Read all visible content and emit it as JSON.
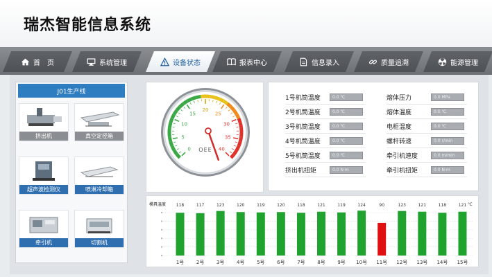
{
  "app": {
    "title": "瑞杰智能信息系统"
  },
  "tabs": [
    {
      "label": "首　页",
      "icon": "home-icon",
      "active": false
    },
    {
      "label": "系统管理",
      "icon": "monitor-icon",
      "active": false
    },
    {
      "label": "设备状态",
      "icon": "warning-icon",
      "active": true
    },
    {
      "label": "报表中心",
      "icon": "book-icon",
      "active": false
    },
    {
      "label": "信息录入",
      "icon": "document-icon",
      "active": false
    },
    {
      "label": "质量追溯",
      "icon": "link-icon",
      "active": false
    },
    {
      "label": "能源管理",
      "icon": "radiation-icon",
      "active": false
    }
  ],
  "line": {
    "title": "J01生产线"
  },
  "equipment": [
    {
      "label": "挤出机",
      "style": "gray"
    },
    {
      "label": "真空定径箱",
      "style": "gray"
    },
    {
      "label": "超声波检测仪",
      "style": "blue"
    },
    {
      "label": "喷淋冷却箱",
      "style": "blue"
    },
    {
      "label": "牵引机",
      "style": "blue"
    },
    {
      "label": "切割机",
      "style": "blue"
    }
  ],
  "gauge": {
    "label": "OEE",
    "ticks": [
      "0",
      "5",
      "10",
      "15",
      "20",
      "25",
      "30",
      "35",
      "40"
    ],
    "value": 20,
    "max": 40
  },
  "params_left": [
    {
      "label": "1号机筒温度",
      "value": "0.0 ℃"
    },
    {
      "label": "2号机筒温度",
      "value": "0.0 ℃"
    },
    {
      "label": "3号机筒温度",
      "value": "0.0 ℃"
    },
    {
      "label": "4号机筒温度",
      "value": "0.0 ℃"
    },
    {
      "label": "5号机筒温度",
      "value": "0.0 ℃"
    },
    {
      "label": "挤出机扭矩",
      "value": "0.0 N·m"
    }
  ],
  "params_right": [
    {
      "label": "熔体压力",
      "value": "0.0 MPa"
    },
    {
      "label": "熔体温度",
      "value": "0.0 ℃"
    },
    {
      "label": "电柜温度",
      "value": "0.0 ℃"
    },
    {
      "label": "螺杆转速",
      "value": "0.0 r/min"
    },
    {
      "label": "牵引机速度",
      "value": "0.0 m/min"
    },
    {
      "label": "牵引机扭矩",
      "value": "0.0 N·m"
    }
  ],
  "chart_data": {
    "type": "bar",
    "ylabel": "模具温度",
    "unit": "℃",
    "categories": [
      "1号",
      "2号",
      "3号",
      "4号",
      "5号",
      "6号",
      "7号",
      "8号",
      "9号",
      "10号",
      "11号",
      "12号",
      "13号",
      "14号",
      "15号"
    ],
    "values": [
      118,
      117,
      123,
      120,
      119,
      120,
      118,
      121,
      119,
      124,
      90,
      123,
      121,
      118,
      121
    ],
    "ylim": [
      0,
      130
    ],
    "colors": {
      "normal": "#1fa22e",
      "alarm": "#e01010"
    },
    "alarm_index": 10
  }
}
